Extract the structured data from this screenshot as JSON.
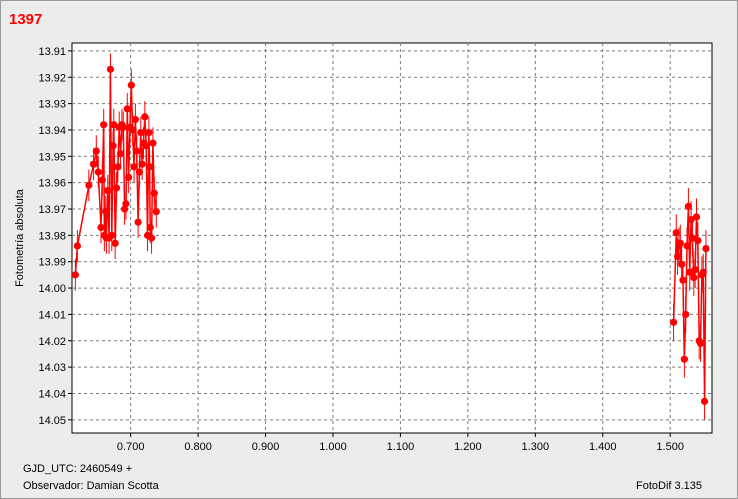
{
  "header": {
    "title": "1397"
  },
  "footer": {
    "gjd": "GJD_UTC: 2460549 +",
    "observer": "Observador: Damian Scotta",
    "software": "FotoDif 3.135"
  },
  "colors": {
    "series": "#ff0000",
    "grid": "#7a7a7a",
    "background": "#ffffff"
  },
  "chart_data": {
    "type": "scatter",
    "title": "1397",
    "xlabel": "",
    "ylabel": "Fotometría absoluta",
    "xlim": [
      0.613,
      1.562
    ],
    "ylim": [
      14.055,
      13.907
    ],
    "y_inverted": true,
    "grid": true,
    "error_bars": true,
    "connected_lines": true,
    "xticks": [
      0.7,
      0.8,
      0.9,
      1.0,
      1.1,
      1.2,
      1.3,
      1.4,
      1.5
    ],
    "xtick_labels": [
      "0.700",
      "0.800",
      "0.900",
      "1.000",
      "1.100",
      "1.200",
      "1.300",
      "1.400",
      "1.500"
    ],
    "yticks": [
      13.91,
      13.92,
      13.93,
      13.94,
      13.95,
      13.96,
      13.97,
      13.98,
      13.99,
      14.0,
      14.01,
      14.02,
      14.03,
      14.04,
      14.05
    ],
    "ytick_labels": [
      "13.91",
      "13.92",
      "13.93",
      "13.94",
      "13.95",
      "13.96",
      "13.97",
      "13.98",
      "13.99",
      "14.00",
      "14.01",
      "14.02",
      "14.03",
      "14.04",
      "14.05"
    ],
    "series": [
      {
        "name": "",
        "x": [
          0.618,
          0.621,
          0.638,
          0.645,
          0.649,
          0.652,
          0.656,
          0.658,
          0.66,
          0.661,
          0.663,
          0.664,
          0.666,
          0.668,
          0.67,
          0.672,
          0.674,
          0.675,
          0.677,
          0.679,
          0.681,
          0.683,
          0.685,
          0.687,
          0.689,
          0.691,
          0.693,
          0.695,
          0.697,
          0.699,
          0.701,
          0.703,
          0.705,
          0.707,
          0.709,
          0.711,
          0.713,
          0.715,
          0.717,
          0.719,
          0.721,
          0.723,
          0.725,
          0.727,
          0.728,
          0.729,
          0.731,
          0.733,
          0.735,
          0.738
        ],
        "y": [
          13.995,
          13.984,
          13.961,
          13.953,
          13.948,
          13.956,
          13.977,
          13.959,
          13.938,
          13.98,
          13.971,
          13.981,
          13.963,
          13.981,
          13.917,
          13.98,
          13.946,
          13.938,
          13.983,
          13.962,
          13.954,
          13.939,
          13.949,
          13.938,
          13.939,
          13.97,
          13.968,
          13.932,
          13.958,
          13.939,
          13.923,
          13.94,
          13.954,
          13.936,
          13.948,
          13.975,
          13.956,
          13.941,
          13.953,
          13.945,
          13.935,
          13.946,
          13.98,
          13.941,
          13.954,
          13.977,
          13.981,
          13.945,
          13.964,
          13.971
        ],
        "error": 0.006
      },
      {
        "name": "",
        "x": [
          1.505,
          1.509,
          1.511,
          1.513,
          1.515,
          1.517,
          1.519,
          1.521,
          1.523,
          1.525,
          1.527,
          1.529,
          1.531,
          1.533,
          1.535,
          1.537,
          1.539,
          1.541,
          1.543,
          1.545,
          1.547,
          1.549,
          1.551,
          1.553
        ],
        "y": [
          14.013,
          13.979,
          13.988,
          13.984,
          13.983,
          13.991,
          13.997,
          14.027,
          14.01,
          13.984,
          13.969,
          13.994,
          13.974,
          13.981,
          13.996,
          13.993,
          13.973,
          13.982,
          14.02,
          14.021,
          13.995,
          13.994,
          14.043,
          13.985
        ],
        "error": 0.007
      }
    ]
  }
}
